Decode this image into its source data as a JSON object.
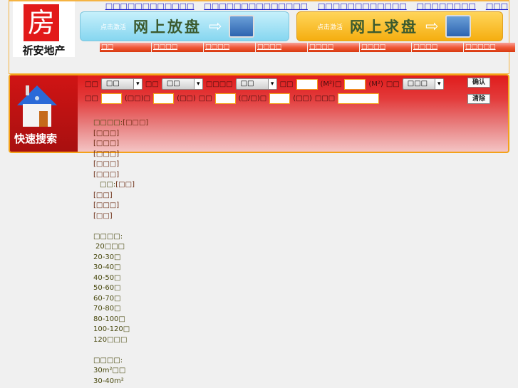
{
  "logo": {
    "name": "祈安地产",
    "seal": "房"
  },
  "top_links": [
    "□□□□□□□□□□□□",
    "□□□□□□□□□□□□□□",
    "□□□□□□□□□□□□",
    "□□□□□□□□",
    "□□□"
  ],
  "banners": [
    {
      "small": "点击激活",
      "big": "网上放盘"
    },
    {
      "small": "点击激活",
      "big": "网上求盘"
    }
  ],
  "nav": [
    "□□",
    "□□□□",
    "□□□□",
    "□□□□",
    "□□□□",
    "□□□□",
    "□□□□",
    "□□□□□"
  ],
  "search": {
    "title": "快速搜索",
    "row1": {
      "l1": "□□",
      "s1": "□□",
      "l2": "□□",
      "s2": "□□",
      "l3": "□□□□",
      "s3": "□□",
      "l4": "□□",
      "u1": "(M²)□",
      "u2": "(M²)",
      "l5": "□□",
      "s4": "□□□"
    },
    "row2": {
      "l1": "□□",
      "u1": "(□□)□",
      "u2": "(□□)",
      "l2": "□□",
      "u3": "(□/□)□",
      "u4": "(□□)",
      "l3": "□□□"
    },
    "confirm": "确认",
    "clear": "清除"
  },
  "list": {
    "region_label": "□□□□:",
    "regions": [
      "[□□□]",
      "[□□□]",
      "[□□□]",
      "[□□□]",
      "[□□□]",
      "[□□□]"
    ],
    "sub_label": "□□:",
    "subs": [
      "[□□]",
      "[□□]",
      "[□□□]",
      "[□□]"
    ],
    "price_label": "□□□□:",
    "prices": [
      "20□□□",
      "20-30□",
      "30-40□",
      "40-50□",
      "50-60□",
      "60-70□",
      "70-80□",
      "80-100□",
      "100-120□",
      "120□□□"
    ],
    "area_label": "□□□□:",
    "areas": [
      "30m²□□",
      "30-40m²"
    ]
  }
}
